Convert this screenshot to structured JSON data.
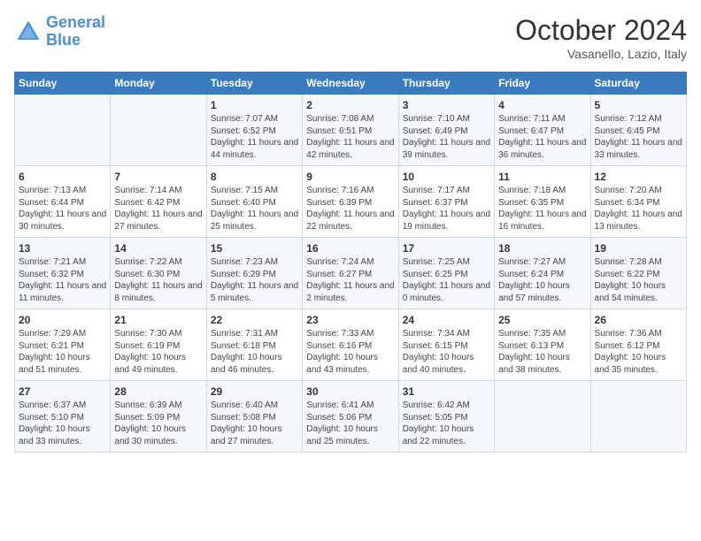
{
  "header": {
    "logo_line1": "General",
    "logo_line2": "Blue",
    "title": "October 2024",
    "subtitle": "Vasanello, Lazio, Italy"
  },
  "days_of_week": [
    "Sunday",
    "Monday",
    "Tuesday",
    "Wednesday",
    "Thursday",
    "Friday",
    "Saturday"
  ],
  "weeks": [
    [
      {
        "day": "",
        "info": ""
      },
      {
        "day": "",
        "info": ""
      },
      {
        "day": "1",
        "info": "Sunrise: 7:07 AM\nSunset: 6:52 PM\nDaylight: 11 hours and 44 minutes."
      },
      {
        "day": "2",
        "info": "Sunrise: 7:08 AM\nSunset: 6:51 PM\nDaylight: 11 hours and 42 minutes."
      },
      {
        "day": "3",
        "info": "Sunrise: 7:10 AM\nSunset: 6:49 PM\nDaylight: 11 hours and 39 minutes."
      },
      {
        "day": "4",
        "info": "Sunrise: 7:11 AM\nSunset: 6:47 PM\nDaylight: 11 hours and 36 minutes."
      },
      {
        "day": "5",
        "info": "Sunrise: 7:12 AM\nSunset: 6:45 PM\nDaylight: 11 hours and 33 minutes."
      }
    ],
    [
      {
        "day": "6",
        "info": "Sunrise: 7:13 AM\nSunset: 6:44 PM\nDaylight: 11 hours and 30 minutes."
      },
      {
        "day": "7",
        "info": "Sunrise: 7:14 AM\nSunset: 6:42 PM\nDaylight: 11 hours and 27 minutes."
      },
      {
        "day": "8",
        "info": "Sunrise: 7:15 AM\nSunset: 6:40 PM\nDaylight: 11 hours and 25 minutes."
      },
      {
        "day": "9",
        "info": "Sunrise: 7:16 AM\nSunset: 6:39 PM\nDaylight: 11 hours and 22 minutes."
      },
      {
        "day": "10",
        "info": "Sunrise: 7:17 AM\nSunset: 6:37 PM\nDaylight: 11 hours and 19 minutes."
      },
      {
        "day": "11",
        "info": "Sunrise: 7:18 AM\nSunset: 6:35 PM\nDaylight: 11 hours and 16 minutes."
      },
      {
        "day": "12",
        "info": "Sunrise: 7:20 AM\nSunset: 6:34 PM\nDaylight: 11 hours and 13 minutes."
      }
    ],
    [
      {
        "day": "13",
        "info": "Sunrise: 7:21 AM\nSunset: 6:32 PM\nDaylight: 11 hours and 11 minutes."
      },
      {
        "day": "14",
        "info": "Sunrise: 7:22 AM\nSunset: 6:30 PM\nDaylight: 11 hours and 8 minutes."
      },
      {
        "day": "15",
        "info": "Sunrise: 7:23 AM\nSunset: 6:29 PM\nDaylight: 11 hours and 5 minutes."
      },
      {
        "day": "16",
        "info": "Sunrise: 7:24 AM\nSunset: 6:27 PM\nDaylight: 11 hours and 2 minutes."
      },
      {
        "day": "17",
        "info": "Sunrise: 7:25 AM\nSunset: 6:25 PM\nDaylight: 11 hours and 0 minutes."
      },
      {
        "day": "18",
        "info": "Sunrise: 7:27 AM\nSunset: 6:24 PM\nDaylight: 10 hours and 57 minutes."
      },
      {
        "day": "19",
        "info": "Sunrise: 7:28 AM\nSunset: 6:22 PM\nDaylight: 10 hours and 54 minutes."
      }
    ],
    [
      {
        "day": "20",
        "info": "Sunrise: 7:29 AM\nSunset: 6:21 PM\nDaylight: 10 hours and 51 minutes."
      },
      {
        "day": "21",
        "info": "Sunrise: 7:30 AM\nSunset: 6:19 PM\nDaylight: 10 hours and 49 minutes."
      },
      {
        "day": "22",
        "info": "Sunrise: 7:31 AM\nSunset: 6:18 PM\nDaylight: 10 hours and 46 minutes."
      },
      {
        "day": "23",
        "info": "Sunrise: 7:33 AM\nSunset: 6:16 PM\nDaylight: 10 hours and 43 minutes."
      },
      {
        "day": "24",
        "info": "Sunrise: 7:34 AM\nSunset: 6:15 PM\nDaylight: 10 hours and 40 minutes."
      },
      {
        "day": "25",
        "info": "Sunrise: 7:35 AM\nSunset: 6:13 PM\nDaylight: 10 hours and 38 minutes."
      },
      {
        "day": "26",
        "info": "Sunrise: 7:36 AM\nSunset: 6:12 PM\nDaylight: 10 hours and 35 minutes."
      }
    ],
    [
      {
        "day": "27",
        "info": "Sunrise: 6:37 AM\nSunset: 5:10 PM\nDaylight: 10 hours and 33 minutes."
      },
      {
        "day": "28",
        "info": "Sunrise: 6:39 AM\nSunset: 5:09 PM\nDaylight: 10 hours and 30 minutes."
      },
      {
        "day": "29",
        "info": "Sunrise: 6:40 AM\nSunset: 5:08 PM\nDaylight: 10 hours and 27 minutes."
      },
      {
        "day": "30",
        "info": "Sunrise: 6:41 AM\nSunset: 5:06 PM\nDaylight: 10 hours and 25 minutes."
      },
      {
        "day": "31",
        "info": "Sunrise: 6:42 AM\nSunset: 5:05 PM\nDaylight: 10 hours and 22 minutes."
      },
      {
        "day": "",
        "info": ""
      },
      {
        "day": "",
        "info": ""
      }
    ]
  ]
}
